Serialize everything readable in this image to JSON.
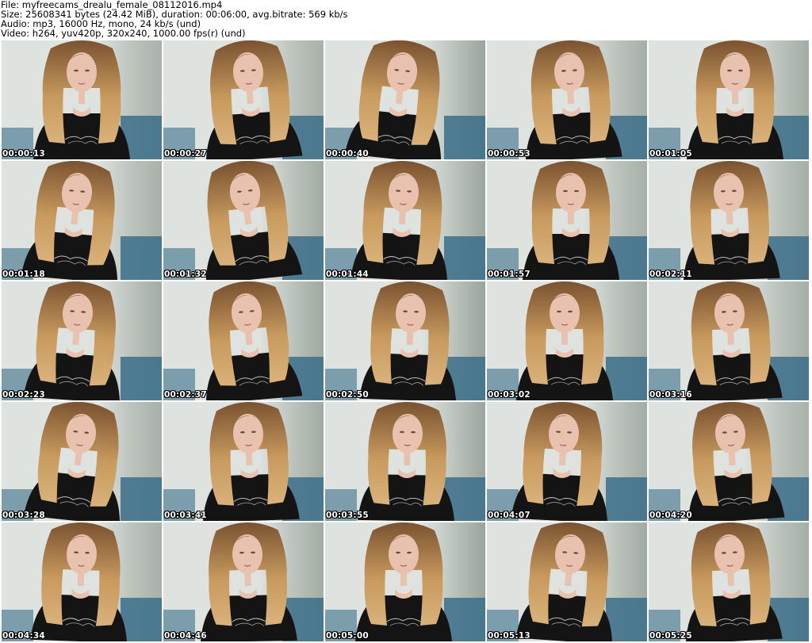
{
  "header": {
    "file_line": "File: myfreecams_drealu_female_08112016.mp4",
    "size_line": "Size: 25608341 bytes (24.42 MiB), duration: 00:06:00, avg.bitrate: 569 kb/s",
    "audio_line": "Audio: mp3, 16000 Hz, mono, 24 kb/s (und)",
    "video_line": "Video: h264, yuv420p, 320x240, 1000.00 fps(r) (und)"
  },
  "colors": {
    "wall_light": "#dfe3df",
    "wall_shadow": "#9aa49c",
    "couch_blue": "#3b6f8a",
    "hair_light": "#c89a5e",
    "hair_dark": "#7a5230",
    "skin": "#e8c2ae",
    "shirt": "#141414",
    "timestamp_text": "#ffffff"
  },
  "thumbnails": [
    {
      "timestamp": "00:00:13"
    },
    {
      "timestamp": "00:00:27"
    },
    {
      "timestamp": "00:00:40"
    },
    {
      "timestamp": "00:00:53"
    },
    {
      "timestamp": "00:01:05"
    },
    {
      "timestamp": "00:01:18"
    },
    {
      "timestamp": "00:01:32"
    },
    {
      "timestamp": "00:01:44"
    },
    {
      "timestamp": "00:01:57"
    },
    {
      "timestamp": "00:02:11"
    },
    {
      "timestamp": "00:02:23"
    },
    {
      "timestamp": "00:02:37"
    },
    {
      "timestamp": "00:02:50"
    },
    {
      "timestamp": "00:03:02"
    },
    {
      "timestamp": "00:03:16"
    },
    {
      "timestamp": "00:03:28"
    },
    {
      "timestamp": "00:03:41"
    },
    {
      "timestamp": "00:03:55"
    },
    {
      "timestamp": "00:04:07"
    },
    {
      "timestamp": "00:04:20"
    },
    {
      "timestamp": "00:04:34"
    },
    {
      "timestamp": "00:04:46"
    },
    {
      "timestamp": "00:05:00"
    },
    {
      "timestamp": "00:05:13"
    },
    {
      "timestamp": "00:05:25"
    }
  ]
}
